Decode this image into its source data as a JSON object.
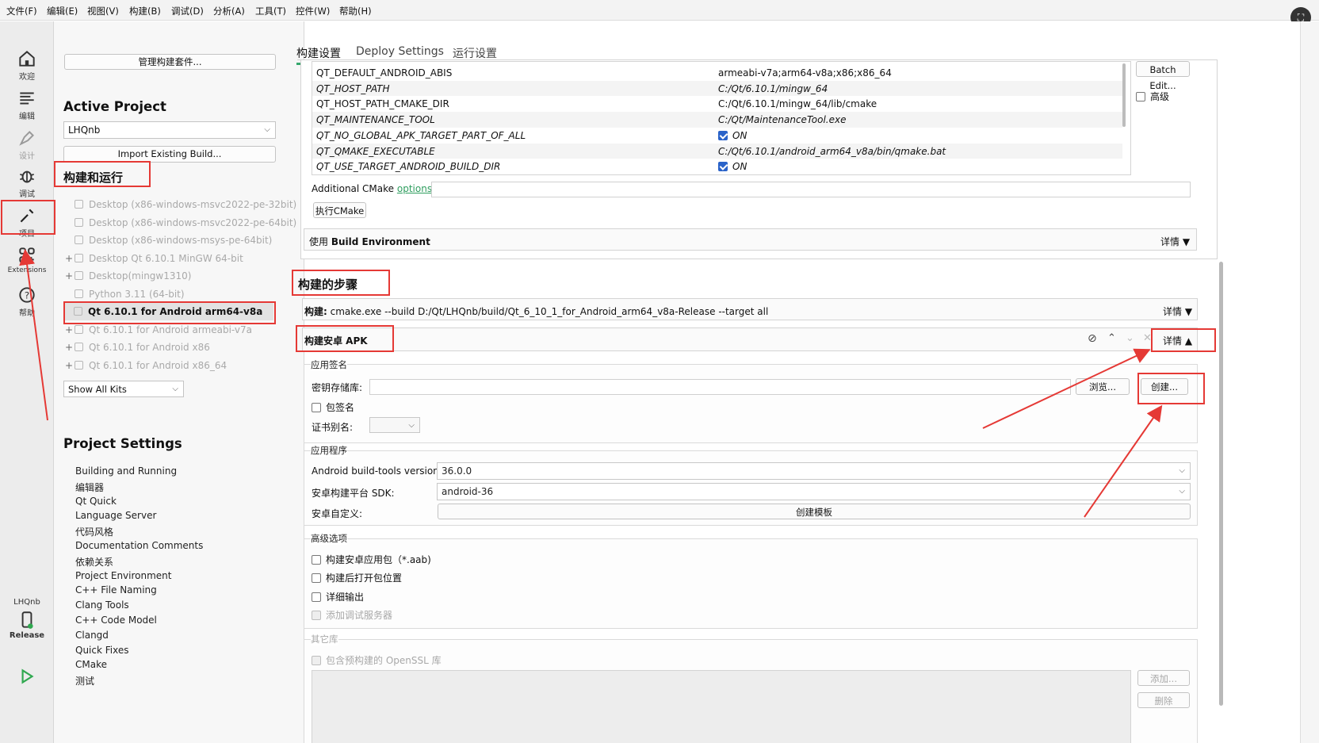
{
  "menubar": {
    "items": [
      "文件(F)",
      "编辑(E)",
      "视图(V)",
      "构建(B)",
      "调试(D)",
      "分析(A)",
      "工具(T)",
      "控件(W)",
      "帮助(H)"
    ]
  },
  "modebar": {
    "welcome": "欢迎",
    "edit": "编辑",
    "design": "设计",
    "debug": "调试",
    "projects": "项目",
    "extensions": "Extensions",
    "help": "帮助",
    "project_name": "LHQnb",
    "build_config": "Release"
  },
  "projpanel": {
    "manage_kits": "管理构建套件...",
    "active_project_heading": "Active Project",
    "active_project_value": "LHQnb",
    "import_build": "Import Existing Build...",
    "build_run_heading": "构建和运行",
    "kits": [
      {
        "label": "Desktop (x86-windows-msvc2022-pe-32bit)",
        "plus": ""
      },
      {
        "label": "Desktop (x86-windows-msvc2022-pe-64bit)",
        "plus": ""
      },
      {
        "label": "Desktop (x86-windows-msys-pe-64bit)",
        "plus": ""
      },
      {
        "label": "Desktop Qt 6.10.1 MinGW 64-bit",
        "plus": "+"
      },
      {
        "label": "Desktop(mingw1310)",
        "plus": "+"
      },
      {
        "label": "Python 3.11 (64-bit)",
        "plus": ""
      },
      {
        "label": "Qt 6.10.1 for Android arm64-v8a",
        "plus": ""
      },
      {
        "label": "Qt 6.10.1 for Android armeabi-v7a",
        "plus": "+"
      },
      {
        "label": "Qt 6.10.1 for Android x86",
        "plus": "+"
      },
      {
        "label": "Qt 6.10.1 for Android x86_64",
        "plus": "+"
      }
    ],
    "show_all_kits": "Show All Kits",
    "project_settings_heading": "Project Settings",
    "settings": [
      "Building and Running",
      "编辑器",
      "Qt Quick",
      "Language Server",
      "代码风格",
      "Documentation Comments",
      "依赖关系",
      "Project Environment",
      "C++ File Naming",
      "Clang Tools",
      "C++ Code Model",
      "Clangd",
      "Quick Fixes",
      "CMake",
      "测试"
    ]
  },
  "main": {
    "tabs": [
      "构建设置",
      "Deploy Settings",
      "运行设置"
    ],
    "cmake_table": [
      {
        "key": "QT_DEFAULT_ANDROID_ABIS",
        "value": "armeabi-v7a;arm64-v8a;x86;x86_64",
        "italic": false,
        "check": false
      },
      {
        "key": "QT_HOST_PATH",
        "value": "C:/Qt/6.10.1/mingw_64",
        "italic": true,
        "check": false
      },
      {
        "key": "QT_HOST_PATH_CMAKE_DIR",
        "value": "C:/Qt/6.10.1/mingw_64/lib/cmake",
        "italic": false,
        "check": false
      },
      {
        "key": "QT_MAINTENANCE_TOOL",
        "value": "C:/Qt/MaintenanceTool.exe",
        "italic": true,
        "check": false
      },
      {
        "key": "QT_NO_GLOBAL_APK_TARGET_PART_OF_ALL",
        "value": "ON",
        "italic": true,
        "check": true
      },
      {
        "key": "QT_QMAKE_EXECUTABLE",
        "value": "C:/Qt/6.10.1/android_arm64_v8a/bin/qmake.bat",
        "italic": true,
        "check": false
      },
      {
        "key": "QT_USE_TARGET_ANDROID_BUILD_DIR",
        "value": "ON",
        "italic": true,
        "check": true
      }
    ],
    "batch_edit": "Batch Edit...",
    "advanced": "高级",
    "additional_cmake": "Additional CMake",
    "options_link": "options",
    "run_cmake": "执行CMake",
    "use_prefix": "使用",
    "build_environment": "Build Environment",
    "details": "详情",
    "build_steps_heading": "构建的步骤",
    "build_step_label": "构建:",
    "build_step_cmd": "cmake.exe --build D:/Qt/LHQnb/build/Qt_6_10_1_for_Android_arm64_v8a-Release --target all",
    "apk_step_title": "构建安卓 APK",
    "signing_group": "应用签名",
    "keystore_label": "密钥存储库:",
    "browse": "浏览...",
    "create": "创建...",
    "sign_package": "包签名",
    "cert_alias": "证书别名:",
    "application_group": "应用程序",
    "build_tools_label": "Android build-tools version:",
    "build_tools_value": "36.0.0",
    "platform_sdk_label": "安卓构建平台 SDK:",
    "platform_sdk_value": "android-36",
    "customize_label": "安卓自定义:",
    "create_templates": "创建模板",
    "advanced_group": "高级选项",
    "opt_aab": "构建安卓应用包（*.aab)",
    "opt_open_location": "构建后打开包位置",
    "opt_verbose": "详细输出",
    "opt_debug_server": "添加调试服务器",
    "other_libs_group": "其它库",
    "openssl": "包含预构建的 OpenSSL 库",
    "add": "添加...",
    "remove": "删除"
  }
}
